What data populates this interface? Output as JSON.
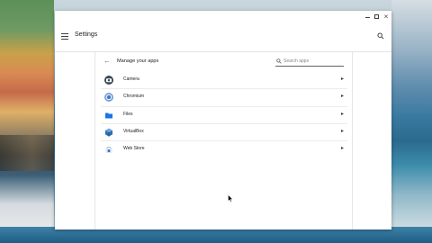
{
  "window": {
    "title": "Settings",
    "caption_buttons": {
      "minimize": "minimize",
      "maximize": "maximize",
      "close": "×"
    }
  },
  "subpage": {
    "title": "Manage your apps",
    "search_placeholder": "Search apps"
  },
  "apps": [
    {
      "label": "Camera",
      "icon": "camera-icon"
    },
    {
      "label": "Chromium",
      "icon": "chromium-icon"
    },
    {
      "label": "Files",
      "icon": "folder-icon"
    },
    {
      "label": "VirtualBox",
      "icon": "virtualbox-icon"
    },
    {
      "label": "Web Store",
      "icon": "web-store-icon"
    }
  ],
  "colors": {
    "accent": "#1a73e8",
    "text": "#202124",
    "icon_grey": "#5f6368"
  }
}
